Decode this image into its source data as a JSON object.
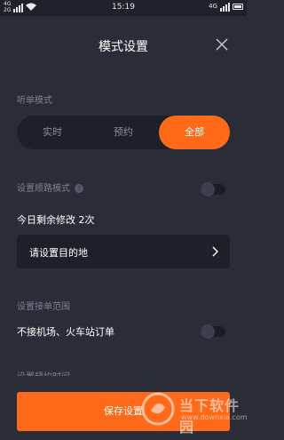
{
  "status_bar": {
    "network_top": "4G",
    "network_bottom": "2G",
    "time": "15:19",
    "network_right": "4G"
  },
  "header": {
    "title": "模式设置",
    "close_icon": "close-icon"
  },
  "listen_mode": {
    "label": "听单模式",
    "options": [
      "实时",
      "预约",
      "全部"
    ],
    "selected": "全部"
  },
  "route_mode": {
    "label": "设置顺路模式",
    "help_icon": "help-icon",
    "enabled": false
  },
  "remaining": {
    "text": "今日剩余修改 2次"
  },
  "destination": {
    "label": "请设置目的地",
    "chevron_icon": "chevron-right-icon"
  },
  "order_range": {
    "label": "设置接单范围",
    "exclude_airport_label": "不接机场、火车站订单",
    "exclude_airport_enabled": false,
    "next_section_partial": "设置预约时间"
  },
  "footer": {
    "save_label": "保存设置"
  },
  "watermark": {
    "brand": "当下软件园",
    "url": "www.downxia.com"
  },
  "colors": {
    "background": "#2a2d38",
    "accent": "#ff6a1a",
    "field": "#1e2029",
    "muted_text": "#7d8190"
  }
}
